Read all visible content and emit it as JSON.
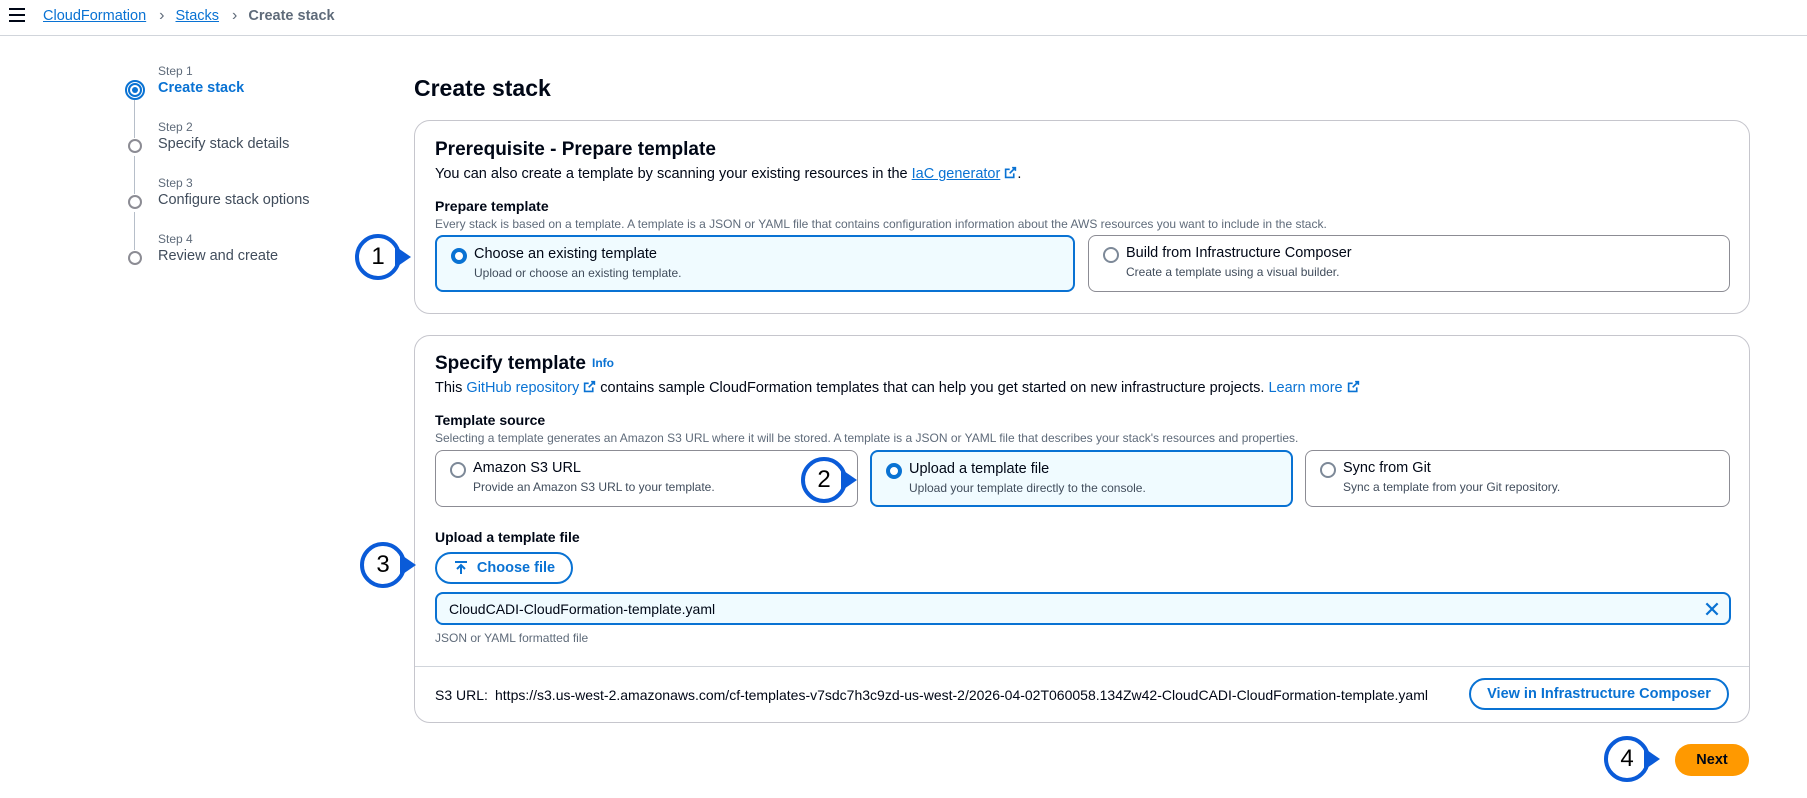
{
  "breadcrumb": {
    "root": "CloudFormation",
    "parent": "Stacks",
    "current": "Create stack"
  },
  "steps": [
    {
      "num": "Step 1",
      "title": "Create stack"
    },
    {
      "num": "Step 2",
      "title": "Specify stack details"
    },
    {
      "num": "Step 3",
      "title": "Configure stack options"
    },
    {
      "num": "Step 4",
      "title": "Review and create"
    }
  ],
  "page": {
    "title": "Create stack"
  },
  "prerequisite": {
    "heading": "Prerequisite - Prepare template",
    "desc_before": "You can also create a template by scanning your existing resources in the ",
    "desc_link": "IaC generator",
    "desc_after": ".",
    "field_label": "Prepare template",
    "field_desc": "Every stack is based on a template. A template is a JSON or YAML file that contains configuration information about the AWS resources you want to include in the stack.",
    "options": [
      {
        "title": "Choose an existing template",
        "desc": "Upload or choose an existing template."
      },
      {
        "title": "Build from Infrastructure Composer",
        "desc": "Create a template using a visual builder."
      }
    ]
  },
  "specify": {
    "heading": "Specify template",
    "info": "Info",
    "desc_before": "This ",
    "desc_link": "GitHub repository",
    "desc_middle": " contains sample CloudFormation templates that can help you get started on new infrastructure projects. ",
    "desc_learn": "Learn more",
    "source_label": "Template source",
    "source_desc": "Selecting a template generates an Amazon S3 URL where it will be stored. A template is a JSON or YAML file that describes your stack's resources and properties.",
    "options": [
      {
        "title": "Amazon S3 URL",
        "desc": "Provide an Amazon S3 URL to your template."
      },
      {
        "title": "Upload a template file",
        "desc": "Upload your template directly to the console."
      },
      {
        "title": "Sync from Git",
        "desc": "Sync a template from your Git repository."
      }
    ],
    "upload_label": "Upload a template file",
    "choose_file": "Choose file",
    "file_name": "CloudCADI-CloudFormation-template.yaml",
    "file_hint": "JSON or YAML formatted file",
    "s3_label": "S3 URL:",
    "s3_url": "https://s3.us-west-2.amazonaws.com/cf-templates-v7sdc7h3c9zd-us-west-2/2026-04-02T060058.134Zw42-CloudCADI-CloudFormation-template.yaml",
    "view_button": "View in Infrastructure Composer"
  },
  "next_button": "Next",
  "callouts": [
    "1",
    "2",
    "3",
    "4"
  ],
  "colors": {
    "accent": "#0972d3",
    "primary_button": "#ff9900",
    "callout": "#0a5bd8",
    "selected_bg": "#f0fbff"
  }
}
